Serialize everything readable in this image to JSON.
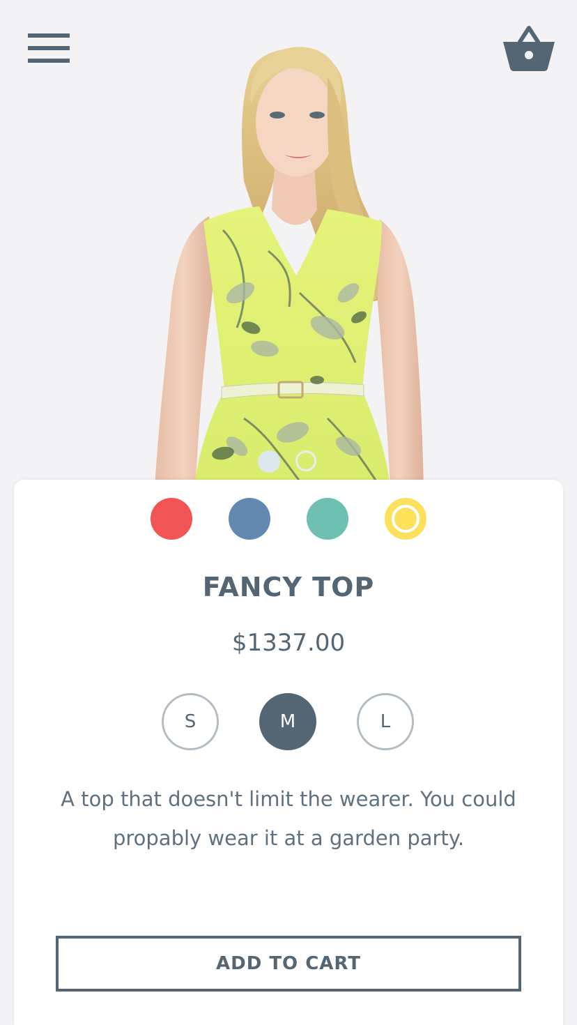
{
  "header": {
    "menu_icon": "hamburger-menu-icon",
    "cart_icon": "shopping-basket-icon"
  },
  "hero": {
    "image_subject": "model-wearing-yellow-floral-top",
    "carousel": {
      "total_slides": 2,
      "active_index": 0
    }
  },
  "colors": {
    "text": "#546673",
    "background": "#f3f3f5",
    "card": "#ffffff"
  },
  "product": {
    "name": "FANCY TOP",
    "price": "$1337.00",
    "description": "A top that doesn't limit the wearer. You could propably wear it at a garden party.",
    "color_options": [
      {
        "name": "red",
        "hex": "#f05454",
        "selected": false
      },
      {
        "name": "blue",
        "hex": "#6389b1",
        "selected": false
      },
      {
        "name": "teal",
        "hex": "#6ec0b2",
        "selected": false
      },
      {
        "name": "yellow",
        "hex": "#fde15c",
        "selected": true
      }
    ],
    "sizes": [
      {
        "label": "S",
        "selected": false
      },
      {
        "label": "M",
        "selected": true
      },
      {
        "label": "L",
        "selected": false
      }
    ]
  },
  "actions": {
    "add_to_cart_label": "ADD TO CART"
  }
}
